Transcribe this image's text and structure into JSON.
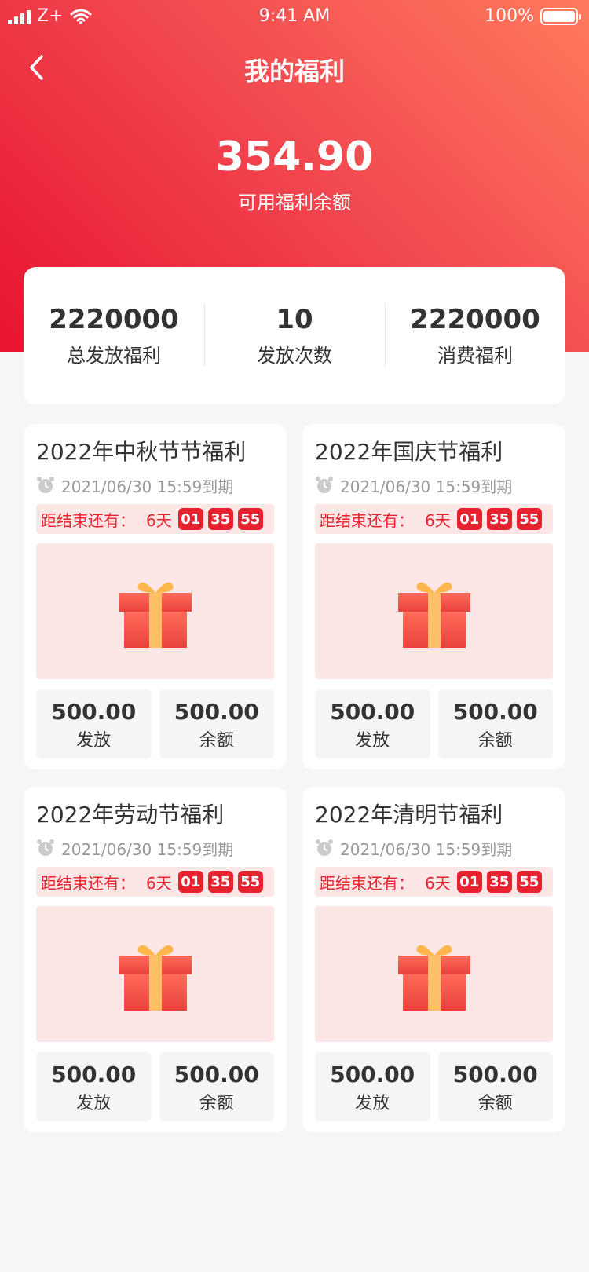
{
  "status_bar": {
    "carrier": "Z+",
    "time": "9:41 AM",
    "battery": "100%"
  },
  "nav": {
    "title": "我的福利"
  },
  "balance": {
    "amount": "354.90",
    "label": "可用福利余额"
  },
  "summary": [
    {
      "value": "2220000",
      "label": "总发放福利"
    },
    {
      "value": "10",
      "label": "发放次数"
    },
    {
      "value": "2220000",
      "label": "消费福利"
    }
  ],
  "cards": [
    {
      "title": "2022年中秋节节福利",
      "expire": "2021/06/30 15:59到期",
      "countdown": {
        "label": "距结束还有：",
        "days": "6天",
        "hours": "01",
        "minutes": "35",
        "seconds": "55"
      },
      "issued": {
        "value": "500.00",
        "label": "发放"
      },
      "balance": {
        "value": "500.00",
        "label": "余额"
      }
    },
    {
      "title": "2022年国庆节福利",
      "expire": "2021/06/30 15:59到期",
      "countdown": {
        "label": "距结束还有：",
        "days": "6天",
        "hours": "01",
        "minutes": "35",
        "seconds": "55"
      },
      "issued": {
        "value": "500.00",
        "label": "发放"
      },
      "balance": {
        "value": "500.00",
        "label": "余额"
      }
    },
    {
      "title": "2022年劳动节福利",
      "expire": "2021/06/30 15:59到期",
      "countdown": {
        "label": "距结束还有：",
        "days": "6天",
        "hours": "01",
        "minutes": "35",
        "seconds": "55"
      },
      "issued": {
        "value": "500.00",
        "label": "发放"
      },
      "balance": {
        "value": "500.00",
        "label": "余额"
      }
    },
    {
      "title": "2022年清明节福利",
      "expire": "2021/06/30 15:59到期",
      "countdown": {
        "label": "距结束还有：",
        "days": "6天",
        "hours": "01",
        "minutes": "35",
        "seconds": "55"
      },
      "issued": {
        "value": "500.00",
        "label": "发放"
      },
      "balance": {
        "value": "500.00",
        "label": "余额"
      }
    }
  ],
  "colors": {
    "accent": "#e8212e",
    "gradient_start": "#e8132f",
    "gradient_end": "#ff7a5c",
    "tint": "#fde6e6"
  },
  "icons": {
    "back": "chevron-left-icon",
    "clock": "alarm-clock-icon",
    "gift": "gift-box-icon"
  }
}
